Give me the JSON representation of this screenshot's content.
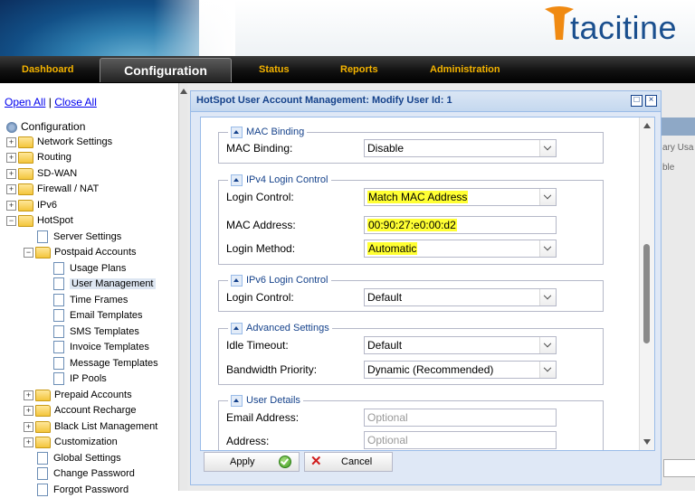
{
  "header": {
    "brand": "tacitine"
  },
  "nav": {
    "items": [
      "Dashboard",
      "Configuration",
      "Status",
      "Reports",
      "Administration"
    ],
    "active": "Configuration"
  },
  "sidebar": {
    "open_all": "Open All",
    "separator": "|",
    "close_all": "Close All",
    "root": "Configuration",
    "items": {
      "network_settings": "Network Settings",
      "routing": "Routing",
      "sd_wan": "SD-WAN",
      "firewall_nat": "Firewall / NAT",
      "ipv6": "IPv6",
      "hotspot": "HotSpot",
      "server_settings": "Server Settings",
      "postpaid_accounts": "Postpaid Accounts",
      "usage_plans": "Usage Plans",
      "user_management": "User Management",
      "time_frames": "Time Frames",
      "email_templates": "Email Templates",
      "sms_templates": "SMS Templates",
      "invoice_templates": "Invoice Templates",
      "message_templates": "Message Templates",
      "ip_pools": "IP Pools",
      "prepaid_accounts": "Prepaid Accounts",
      "account_recharge": "Account Recharge",
      "black_list_management": "Black List Management",
      "customization": "Customization",
      "global_settings": "Global Settings",
      "change_password": "Change Password",
      "forgot_password": "Forgot Password"
    }
  },
  "background": {
    "text1": "ary Usa",
    "text2": "ble"
  },
  "dialog": {
    "title": "HotSpot User Account Management: Modify User Id: 1",
    "tools": {
      "maximize": "□",
      "close": "×"
    },
    "sections": {
      "mac_binding": {
        "legend": "MAC Binding",
        "label": "MAC Binding:",
        "value": "Disable"
      },
      "ipv4": {
        "legend": "IPv4 Login Control",
        "login_control_label": "Login Control:",
        "login_control_value": "Match MAC Address",
        "mac_address_label": "MAC Address:",
        "mac_address_value": "00:90:27:e0:00:d2",
        "login_method_label": "Login Method:",
        "login_method_value": "Automatic"
      },
      "ipv6": {
        "legend": "IPv6 Login Control",
        "login_control_label": "Login Control:",
        "login_control_value": "Default"
      },
      "advanced": {
        "legend": "Advanced Settings",
        "idle_timeout_label": "Idle Timeout:",
        "idle_timeout_value": "Default",
        "bandwidth_label": "Bandwidth Priority:",
        "bandwidth_value": "Dynamic (Recommended)"
      },
      "user_details": {
        "legend": "User Details",
        "email_label": "Email Address:",
        "email_placeholder": "Optional",
        "address_label": "Address:",
        "address_placeholder": "Optional"
      }
    },
    "buttons": {
      "apply": "Apply",
      "cancel": "Cancel"
    }
  },
  "colors": {
    "accent": "#15428b",
    "nav_text": "#f5b400",
    "highlight": "#ffff33"
  }
}
